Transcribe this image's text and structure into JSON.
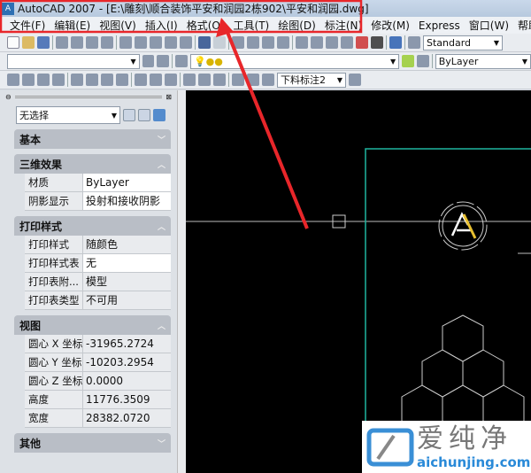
{
  "title": "AutoCAD 2007 - [E:\\雕刻\\顺合装饰平安和润园2栋902\\平安和润园.dwg]",
  "menu": [
    "文件(F)",
    "编辑(E)",
    "视图(V)",
    "插入(I)",
    "格式(O)",
    "工具(T)",
    "绘图(D)",
    "标注(N)",
    "修改(M)",
    "Express",
    "窗口(W)",
    "帮助(H)"
  ],
  "toolbar": {
    "text_style": "Standard",
    "layer_color": "ByLayer",
    "dim_style": "下料标注2"
  },
  "properties": {
    "selection": "无选择",
    "sections": [
      {
        "title": "基本",
        "rows": []
      },
      {
        "title": "三维效果",
        "rows": [
          {
            "k": "材质",
            "v": "ByLayer"
          },
          {
            "k": "阴影显示",
            "v": "投射和接收阴影"
          }
        ]
      },
      {
        "title": "打印样式",
        "rows": [
          {
            "k": "打印样式",
            "v": "随颜色"
          },
          {
            "k": "打印样式表",
            "v": "无"
          },
          {
            "k": "打印表附...",
            "v": "模型"
          },
          {
            "k": "打印表类型",
            "v": "不可用"
          }
        ]
      },
      {
        "title": "视图",
        "rows": [
          {
            "k": "圆心 X 坐标",
            "v": "-31965.2724"
          },
          {
            "k": "圆心 Y 坐标",
            "v": "-10203.2954"
          },
          {
            "k": "圆心 Z 坐标",
            "v": "0.0000"
          },
          {
            "k": "高度",
            "v": "11776.3509"
          },
          {
            "k": "宽度",
            "v": "28382.0720"
          }
        ]
      },
      {
        "title": "其他",
        "rows": []
      }
    ]
  },
  "watermark": {
    "cn": "爱纯净",
    "url": "aichunjing.com"
  },
  "colors": {
    "highlight": "#e8262a",
    "canvas": "#000000",
    "cyan": "#1fb5a0"
  }
}
